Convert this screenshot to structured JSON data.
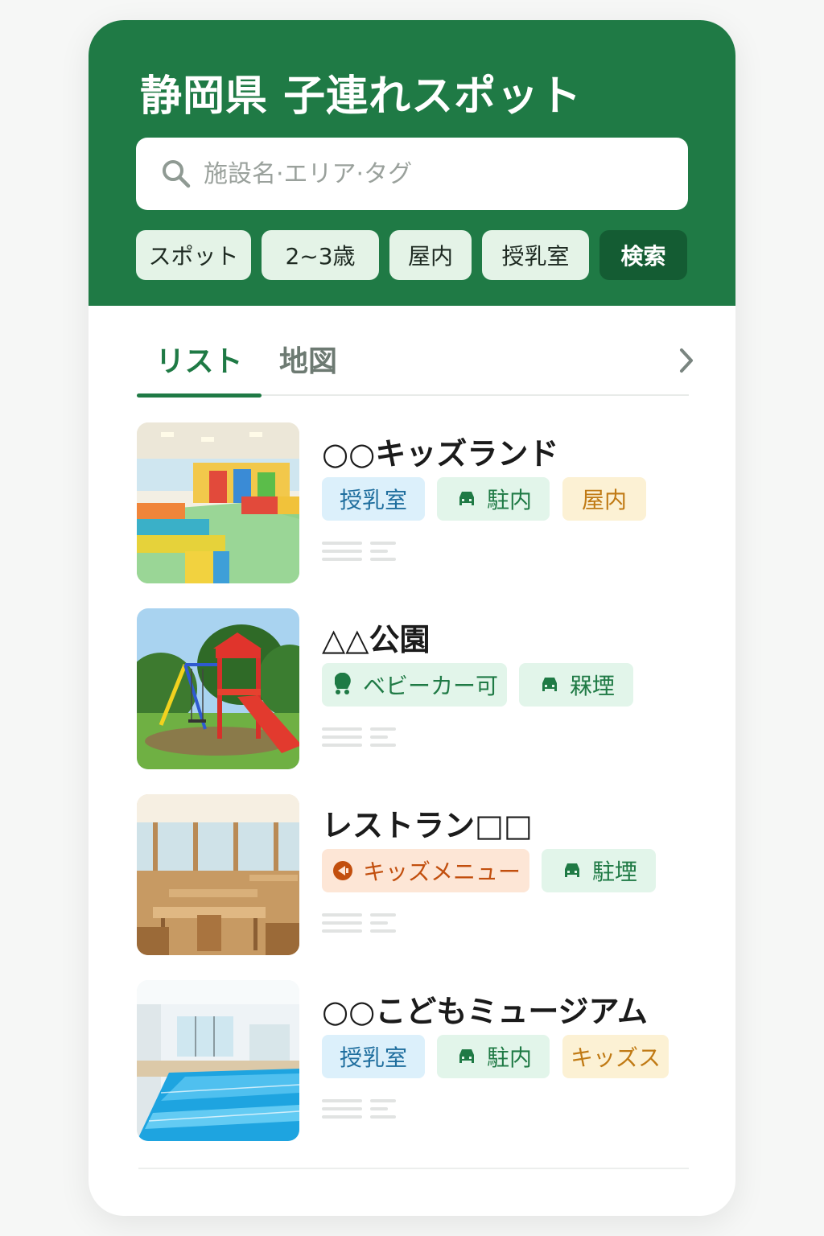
{
  "header": {
    "title": "静岡県 子連れスポット",
    "search_placeholder": "施設名·エリア·タグ",
    "search_value": "",
    "filters": [
      {
        "label": "スポット"
      },
      {
        "label": "2~3歳"
      },
      {
        "label": "屋内"
      },
      {
        "label": "授乳室"
      },
      {
        "label": "検索"
      }
    ]
  },
  "tabs": [
    {
      "label": "リスト",
      "active": true
    },
    {
      "label": "地図",
      "active": false
    }
  ],
  "spots": [
    {
      "name": "○○キッズランド",
      "image": "indoor-playground",
      "tags": [
        {
          "label": "授乳室",
          "icon": "",
          "color": "blue"
        },
        {
          "label": "駐内",
          "icon": "car-icon",
          "color": "green"
        },
        {
          "label": "屋内",
          "icon": "",
          "color": "yellow"
        }
      ]
    },
    {
      "name": "△△公園",
      "image": "park-playground",
      "tags": [
        {
          "label": "ベビーカー可",
          "icon": "stroller-icon",
          "color": "green"
        },
        {
          "label": "槑堙",
          "icon": "car-icon",
          "color": "green"
        }
      ]
    },
    {
      "name": "レストラン□□",
      "image": "restaurant-interior",
      "tags": [
        {
          "label": "キッズメニュー",
          "icon": "megaphone-icon",
          "color": "orange"
        },
        {
          "label": "駐堙",
          "icon": "car-icon",
          "color": "green"
        }
      ]
    },
    {
      "name": "○○こどもミュージアム",
      "image": "indoor-pool",
      "tags": [
        {
          "label": "授乳室",
          "icon": "",
          "color": "blue"
        },
        {
          "label": "駐内",
          "icon": "car-icon",
          "color": "green"
        },
        {
          "label": "キッズス",
          "icon": "",
          "color": "yellow"
        }
      ]
    }
  ],
  "colors": {
    "header_bg": "#1f7a45",
    "primary_button": "#145c33",
    "chip_bg": "#e4f3e7",
    "tag_blue": "#dcf0fb",
    "tag_green": "#e2f5ea",
    "tag_yellow": "#fcf1d4",
    "tag_orange": "#fde6d6"
  }
}
